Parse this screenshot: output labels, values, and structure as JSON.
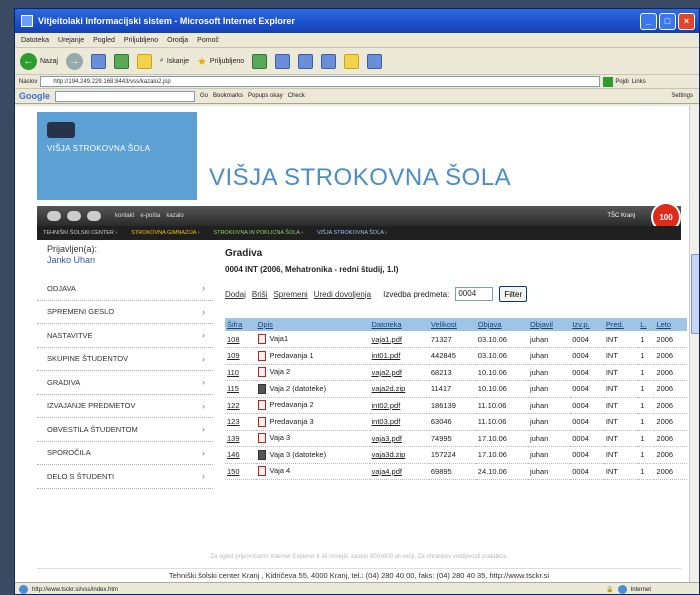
{
  "window": {
    "title": "Vitjeitolaki Informacijski sistem - Microsoft Internet Explorer"
  },
  "menu": [
    "Datoteka",
    "Urejanje",
    "Pogled",
    "Priljubljeno",
    "Orodja",
    "Pomoč"
  ],
  "toolbar": {
    "back": "Nazaj",
    "search": "Iskanje",
    "favorites": "Priljubljeno"
  },
  "address": {
    "label": "Naslov",
    "value": "http://194.249.229.168:8443/vss/kazalo2.jsp",
    "go": "Pojdi",
    "links": "Links"
  },
  "googlebar": {
    "label": "Google",
    "go": "Go",
    "bookmarks": "Bookmarks",
    "popups": "Popups okay",
    "check": "Check",
    "settings": "Settings"
  },
  "site": {
    "logo_text": "VIŠJA STROKOVNA ŠOLA",
    "title": "VIŠJA STROKOVNA ŠOLA",
    "nav": [
      "kontakt",
      "e-pošta",
      "kazalo"
    ],
    "nav_right": "TŠC Kranj",
    "badge": "100",
    "subnav": [
      "TEHNIŠKI ŠOLSKI CENTER ›",
      "STROKOVNA GIMNAZIJA ›",
      "STROKOVNA IN POKLICNA ŠOLA ›",
      "VIŠJA STROKOVNA ŠOLA ›"
    ]
  },
  "sidebar": {
    "login_label": "Prijavljen(a):",
    "login_name": "Janko Uhan",
    "items": [
      {
        "label": "ODJAVA"
      },
      {
        "label": "SPREMENI GESLO"
      },
      {
        "label": "NASTAVITVE"
      },
      {
        "label": "SKUPINE ŠTUDENTOV"
      },
      {
        "label": "GRADIVA"
      },
      {
        "label": "IZVAJANJE PREDMETOV"
      },
      {
        "label": "OBVESTILA ŠTUDENTOM"
      },
      {
        "label": "SPOROČILA"
      },
      {
        "label": "DELO S ŠTUDENTI"
      }
    ]
  },
  "main": {
    "title": "Gradiva",
    "subtitle": "0004 INT (2006, Mehatronika - redni študij, 1.l)",
    "actions": [
      "Dodaj",
      "Briši",
      "Spremeni",
      "Uredi dovoljenja"
    ],
    "filter_label": "Izvedba predmeta:",
    "filter_value": "0004",
    "filter_button": "Filter",
    "columns": [
      "Šifra",
      "Opis",
      "Datoteka",
      "Velikost",
      "Objava",
      "Objavil",
      "Izv.p.",
      "Pred.",
      "L.",
      "Leto"
    ],
    "rows": [
      [
        "108",
        "Vaja1",
        "vaja1.pdf",
        "71327",
        "03.10.06",
        "juhan",
        "0004",
        "INT",
        "1",
        "2006"
      ],
      [
        "109",
        "Predavanja 1",
        "int01.pdf",
        "442845",
        "03.10.06",
        "juhan",
        "0004",
        "INT",
        "1",
        "2006"
      ],
      [
        "110",
        "Vaja 2",
        "vaja2.pdf",
        "68213",
        "10.10.06",
        "juhan",
        "0004",
        "INT",
        "1",
        "2006"
      ],
      [
        "115",
        "Vaja 2 (datoteke)",
        "vaja2d.zip",
        "11417",
        "10.10.06",
        "juhan",
        "0004",
        "INT",
        "1",
        "2006"
      ],
      [
        "122",
        "Predavanja 2",
        "int02.pdf",
        "186139",
        "11.10.06",
        "juhan",
        "0004",
        "INT",
        "1",
        "2006"
      ],
      [
        "123",
        "Predavanja 3",
        "int03.pdf",
        "63046",
        "11.10.06",
        "juhan",
        "0004",
        "INT",
        "1",
        "2006"
      ],
      [
        "139",
        "Vaja 3",
        "vaja3.pdf",
        "74995",
        "17.10.06",
        "juhan",
        "0004",
        "INT",
        "1",
        "2006"
      ],
      [
        "146",
        "Vaja 3 (datoteke)",
        "vaja3d.zip",
        "157224",
        "17.10.06",
        "juhan",
        "0004",
        "INT",
        "1",
        "2006"
      ],
      [
        "150",
        "Vaja 4",
        "vaja4.pdf",
        "69895",
        "24.10.06",
        "juhan",
        "0004",
        "INT",
        "1",
        "2006"
      ]
    ]
  },
  "footer": {
    "warning": "Za ogled priporočamo Internet Explorer 6 ali novejši, zaslon 800x600 ali večji. Za ohranitev vnetljivosti podatkov.",
    "address": "Tehniški šolski center Kranj , Kidričeva 55, 4000 Kranj, tel.: (04) 280 40 00, faks: (04) 280 40 35, http://www.tsckr.si"
  },
  "status": {
    "url": "http://www.tsckr.si/vss/index.htm",
    "zone": "Internet"
  }
}
